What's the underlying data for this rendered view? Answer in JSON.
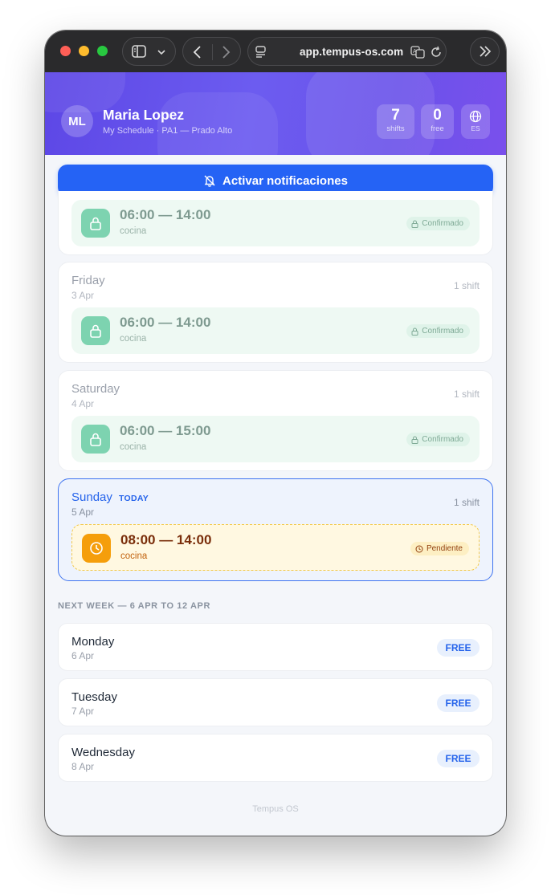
{
  "browser": {
    "url": "app.tempus-os.com"
  },
  "header": {
    "avatar_initials": "ML",
    "user_name": "Maria Lopez",
    "subtitle": "My Schedule · PA1 — Prado Alto",
    "stats": [
      {
        "value": "7",
        "label": "shifts"
      },
      {
        "value": "0",
        "label": "free"
      }
    ],
    "language": "ES"
  },
  "notify_button": {
    "label": "Activar notificaciones"
  },
  "days": [
    {
      "name": "",
      "date": "",
      "count": "",
      "shift": {
        "time": "06:00 — 14:00",
        "place": "cocina",
        "status": "Confirmado"
      }
    },
    {
      "name": "Friday",
      "date": "3 Apr",
      "count": "1 shift",
      "shift": {
        "time": "06:00 — 14:00",
        "place": "cocina",
        "status": "Confirmado"
      }
    },
    {
      "name": "Saturday",
      "date": "4 Apr",
      "count": "1 shift",
      "shift": {
        "time": "06:00 — 15:00",
        "place": "cocina",
        "status": "Confirmado"
      }
    },
    {
      "name": "Sunday",
      "today_tag": "TODAY",
      "date": "5 Apr",
      "count": "1 shift",
      "shift": {
        "time": "08:00 — 14:00",
        "place": "cocina",
        "status": "Pendiente"
      }
    }
  ],
  "next_week": {
    "label": "NEXT WEEK — 6 APR TO 12 APR",
    "days": [
      {
        "name": "Monday",
        "date": "6 Apr",
        "status": "FREE"
      },
      {
        "name": "Tuesday",
        "date": "7 Apr",
        "status": "FREE"
      },
      {
        "name": "Wednesday",
        "date": "8 Apr",
        "status": "FREE"
      }
    ]
  },
  "footer": "Tempus OS",
  "colors": {
    "accent": "#2563f5",
    "header_gradient_start": "#5d47e6",
    "confirmed": "#7dd3b0",
    "pending": "#f59e0b"
  }
}
